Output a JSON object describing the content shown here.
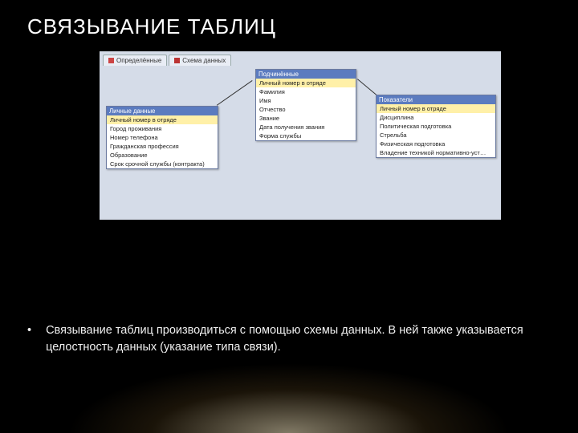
{
  "title": "СВЯЗЫВАНИЕ ТАБЛИЦ",
  "bullet": {
    "mark": "•",
    "text": "Связывание таблиц производиться с помощью схемы данных. В ней также указывается целостность данных (указание типа связи)."
  },
  "tabs": {
    "t1": "Определённые",
    "t2": "Схема данных"
  },
  "tables": {
    "left": {
      "header": "Личные данные",
      "pk": "Личный номер в отряде",
      "r1": "Город проживания",
      "r2": "Номер телефона",
      "r3": "Гражданская профессия",
      "r4": "Образование",
      "r5": "Срок срочной службы (контракта)"
    },
    "mid": {
      "header": "Подчинённые",
      "pk": "Личный номер в отряде",
      "r1": "Фамилия",
      "r2": "Имя",
      "r3": "Отчество",
      "r4": "Звание",
      "r5": "Дата получения звания",
      "r6": "Форма службы"
    },
    "right": {
      "header": "Показатели",
      "pk": "Личный номер в отряде",
      "r1": "Дисциплина",
      "r2": "Политическая подготовка",
      "r3": "Стрельба",
      "r4": "Физическая подготовка",
      "r5": "Владение техникой нормативно-уст…"
    }
  }
}
